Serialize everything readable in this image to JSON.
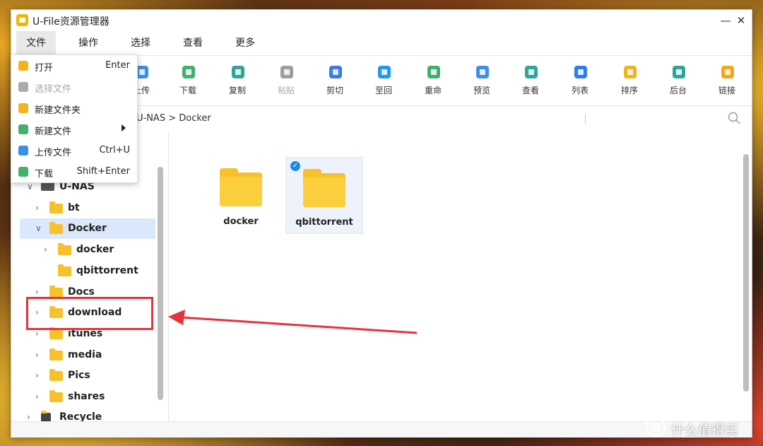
{
  "window": {
    "title": "U-File资源管理器"
  },
  "menubar": [
    "文件",
    "操作",
    "选择",
    "查看",
    "更多"
  ],
  "toolbar": [
    {
      "label": "上传",
      "icon": "upload-icon",
      "color": "#3b8fe8",
      "disabled": false
    },
    {
      "label": "下载",
      "icon": "download-icon",
      "color": "#43b06f",
      "disabled": false
    },
    {
      "label": "复制",
      "icon": "copy-icon",
      "color": "#2fa69a",
      "disabled": false
    },
    {
      "label": "粘贴",
      "icon": "paste-icon",
      "color": "#9e9e9e",
      "disabled": true
    },
    {
      "label": "剪切",
      "icon": "scissors-icon",
      "color": "#3b7be8",
      "disabled": false
    },
    {
      "label": "至回",
      "icon": "trash-icon",
      "color": "#2196f3",
      "disabled": false
    },
    {
      "label": "重命",
      "icon": "rename-icon",
      "color": "#43b06f",
      "disabled": false
    },
    {
      "label": "预览",
      "icon": "eye-icon",
      "color": "#3b8fe8",
      "disabled": false
    },
    {
      "label": "查看",
      "icon": "view-icon",
      "color": "#2fa69a",
      "disabled": false
    },
    {
      "label": "列表",
      "icon": "list-icon",
      "color": "#2f7de8",
      "disabled": false
    },
    {
      "label": "排序",
      "icon": "sort-icon",
      "color": "#f3b31c",
      "disabled": false
    },
    {
      "label": "后台",
      "icon": "background-icon",
      "color": "#2fa69a",
      "disabled": false
    },
    {
      "label": "链接",
      "icon": "link-icon",
      "color": "#f3a71c",
      "disabled": false
    }
  ],
  "path": "U-NAS > Docker",
  "file_menu": [
    {
      "label": "打开",
      "shortcut": "Enter",
      "icon": "open-icon",
      "color": "#f3b31c",
      "disabled": false,
      "submenu": false
    },
    {
      "label": "选择文件",
      "shortcut": "",
      "icon": "cursor-icon",
      "color": "#aaaaaa",
      "disabled": true,
      "submenu": false
    },
    {
      "label": "新建文件夹",
      "shortcut": "",
      "icon": "new-folder-icon",
      "color": "#f3b31c",
      "disabled": false,
      "submenu": false
    },
    {
      "label": "新建文件",
      "shortcut": "",
      "icon": "new-file-icon",
      "color": "#43b06f",
      "disabled": false,
      "submenu": true
    },
    {
      "label": "上传文件",
      "shortcut": "Ctrl+U",
      "icon": "cloud-upload-icon",
      "color": "#3b8fe8",
      "disabled": false,
      "submenu": false
    },
    {
      "label": "下载",
      "shortcut": "Shift+Enter",
      "icon": "download-icon",
      "color": "#43b06f",
      "disabled": false,
      "submenu": false
    }
  ],
  "tree": [
    {
      "label": "U-NAS",
      "level": 0,
      "expanded": true,
      "chevron": "down",
      "kind": "drive",
      "selected": false
    },
    {
      "label": "bt",
      "level": 1,
      "chevron": "right",
      "kind": "folder",
      "selected": false
    },
    {
      "label": "Docker",
      "level": 1,
      "chevron": "down",
      "kind": "folder",
      "selected": true
    },
    {
      "label": "docker",
      "level": 2,
      "chevron": "right",
      "kind": "folder",
      "selected": false
    },
    {
      "label": "qbittorrent",
      "level": 2,
      "chevron": "",
      "kind": "folder",
      "selected": false
    },
    {
      "label": "Docs",
      "level": 1,
      "chevron": "right",
      "kind": "folder",
      "selected": false
    },
    {
      "label": "download",
      "level": 1,
      "chevron": "right",
      "kind": "folder",
      "selected": false
    },
    {
      "label": "itunes",
      "level": 1,
      "chevron": "right",
      "kind": "folder",
      "selected": false
    },
    {
      "label": "media",
      "level": 1,
      "chevron": "right",
      "kind": "folder",
      "selected": false
    },
    {
      "label": "Pics",
      "level": 1,
      "chevron": "right",
      "kind": "folder",
      "selected": false
    },
    {
      "label": "shares",
      "level": 1,
      "chevron": "right",
      "kind": "folder",
      "selected": false
    },
    {
      "label": "Recycle",
      "level": 0,
      "chevron": "right",
      "kind": "recycle",
      "selected": false
    }
  ],
  "files": [
    {
      "label": "docker",
      "selected": false
    },
    {
      "label": "qbittorrent",
      "selected": true
    }
  ],
  "annotation": {
    "color": "#e8323a"
  },
  "watermark": {
    "text": "值 什么值得买",
    "logo": "smzdm-logo"
  }
}
